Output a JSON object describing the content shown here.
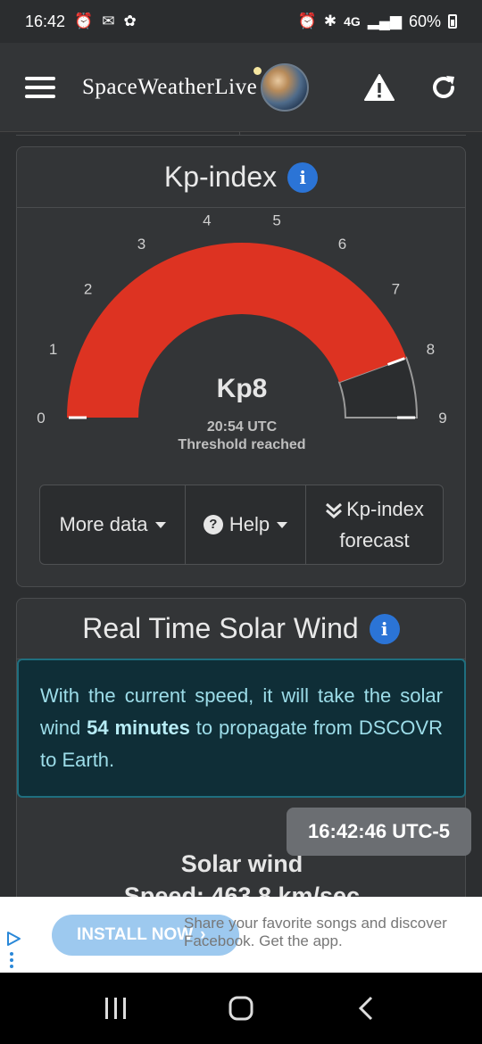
{
  "status_bar": {
    "time": "16:42",
    "network": "4G",
    "battery": "60%"
  },
  "header": {
    "brand": "SpaceWeatherLive"
  },
  "kp_card": {
    "title": "Kp-index",
    "value_label": "Kp8",
    "kp_value": 8,
    "time": "20:54 UTC",
    "status": "Threshold reached",
    "scale": [
      "0",
      "1",
      "2",
      "3",
      "4",
      "5",
      "6",
      "7",
      "8",
      "9"
    ],
    "colors": {
      "fill": "#dd3322",
      "empty": "#2b2d2f",
      "outline": "#9a9a9a"
    }
  },
  "kp_buttons": {
    "more_data": "More data",
    "help": "Help",
    "forecast_line1": "Kp-index",
    "forecast_line2": "forecast"
  },
  "solar_wind_card": {
    "title": "Real Time Solar Wind",
    "alert_part1": "With the current speed, it will take the solar wind",
    "alert_highlight": "54 minutes",
    "alert_part2": "to propagate from DSCOVR to Earth.",
    "section_title": "Solar wind",
    "speed": "Speed: 463.8 km/sec"
  },
  "clock": "16:42:46 UTC-5",
  "ad": {
    "button": "INSTALL NOW",
    "text": "Share your favorite songs and discover Facebook. Get the app."
  }
}
